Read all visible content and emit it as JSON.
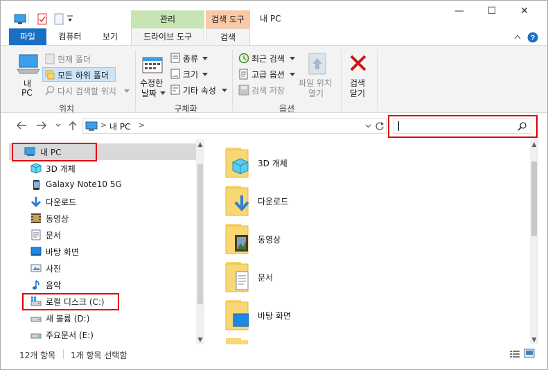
{
  "window": {
    "title": "내 PC",
    "context_tab_manage": "관리",
    "context_tab_search_tools": "검색 도구",
    "minimize_glyph": "—",
    "maximize_glyph": "☐",
    "close_glyph": "✕"
  },
  "ribbon_tabs": {
    "file": "파일",
    "computer": "컴퓨터",
    "view": "보기",
    "drive_tools": "드라이브 도구",
    "search": "검색"
  },
  "ribbon": {
    "location": {
      "this_pc_line1": "내",
      "this_pc_line2": "PC",
      "current_folder": "현재 폴더",
      "all_subfolders": "모든 하위 폴더",
      "search_again_in": "다시 검색할 위치",
      "group_label": "위치"
    },
    "refine": {
      "date_modified_line1": "수정한",
      "date_modified_line2": "날짜",
      "kind": "종류",
      "size": "크기",
      "other_properties": "기타 속성",
      "group_label": "구체화"
    },
    "options": {
      "recent_searches": "최근 검색",
      "advanced_options": "고급 옵션",
      "save_search": "검색 저장",
      "open_file_location_line1": "파일 위치",
      "open_file_location_line2": "열기",
      "group_label": "옵션"
    },
    "close": {
      "close_search_line1": "검색",
      "close_search_line2": "닫기"
    }
  },
  "address_bar": {
    "path_separator": ">",
    "location": "내 PC",
    "trailing_separator": ">"
  },
  "search_box": {
    "value": "",
    "placeholder": ""
  },
  "nav_pane": {
    "items": [
      {
        "label": "내 PC",
        "icon": "this-pc-icon"
      },
      {
        "label": "3D 개체",
        "icon": "3d-objects-icon"
      },
      {
        "label": "Galaxy Note10 5G",
        "icon": "phone-icon"
      },
      {
        "label": "다운로드",
        "icon": "download-icon"
      },
      {
        "label": "동영상",
        "icon": "video-icon"
      },
      {
        "label": "문서",
        "icon": "document-icon"
      },
      {
        "label": "바탕 화면",
        "icon": "desktop-icon"
      },
      {
        "label": "사진",
        "icon": "pictures-icon"
      },
      {
        "label": "음악",
        "icon": "music-icon"
      },
      {
        "label": "로컬 디스크 (C:)",
        "icon": "drive-c-icon"
      },
      {
        "label": "새 볼륨 (D:)",
        "icon": "drive-icon"
      },
      {
        "label": "주요문서 (E:)",
        "icon": "drive-icon"
      }
    ]
  },
  "content": {
    "items": [
      {
        "label": "3D 개체",
        "icon": "3d-objects-folder-icon"
      },
      {
        "label": "다운로드",
        "icon": "downloads-folder-icon"
      },
      {
        "label": "동영상",
        "icon": "videos-folder-icon"
      },
      {
        "label": "문서",
        "icon": "documents-folder-icon"
      },
      {
        "label": "바탕 화면",
        "icon": "desktop-folder-icon"
      }
    ]
  },
  "status_bar": {
    "item_count": "12개 항목",
    "selected_count": "1개 항목 선택함"
  },
  "colors": {
    "file_tab": "#1a6fc2",
    "manage_context": "#c7e4b2",
    "search_tools_context": "#f9c9a6",
    "highlight_box": "#e00000",
    "folder_yellow": "#f8d775"
  }
}
